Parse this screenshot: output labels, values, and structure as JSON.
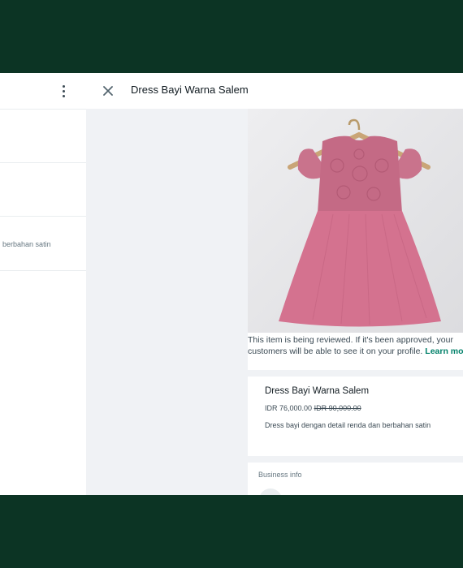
{
  "left_pane": {
    "product_desc_partial": "a dan berbahan satin",
    "menu_icon": "kebab-menu-icon"
  },
  "header": {
    "title": "Dress Bayi Warna Salem",
    "close_icon": "close-icon"
  },
  "review_notice": {
    "text": "This item is being reviewed. If it's been approved, your customers will be able to see it on your profile.",
    "link": "Learn more",
    "end": "."
  },
  "product": {
    "name": "Dress Bayi Warna Salem",
    "price": "IDR 76,000.00",
    "original_price": "IDR 90,000.00",
    "description": "Dress bayi dengan detail renda dan berbahan satin"
  },
  "business_info": {
    "label": "Business info"
  },
  "colors": {
    "frame": "#0c3424",
    "accent": "#008069",
    "dress": "#d4728f"
  }
}
